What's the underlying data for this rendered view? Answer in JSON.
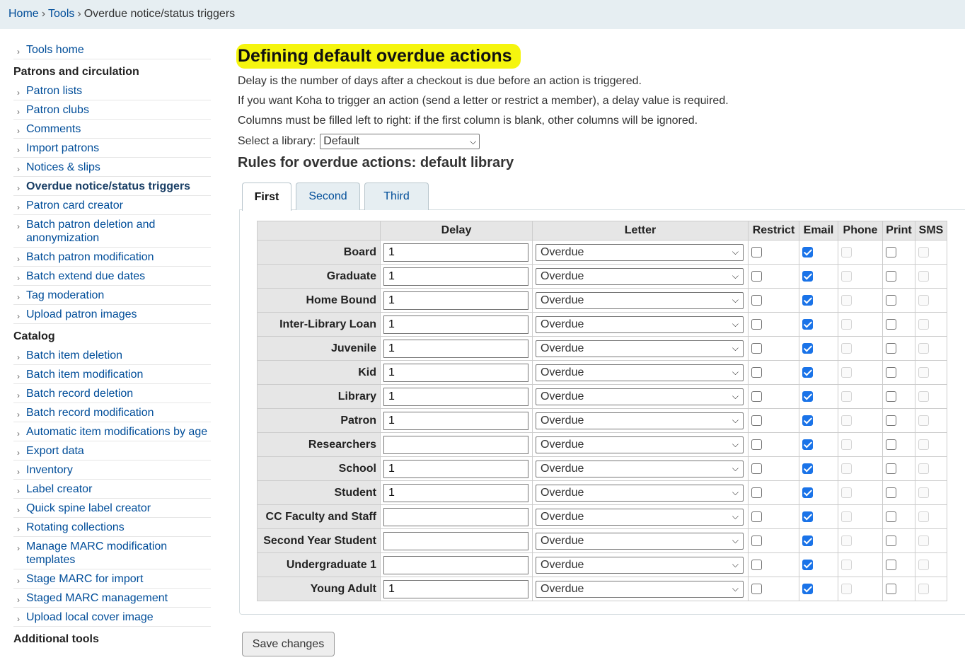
{
  "breadcrumb": {
    "home": "Home",
    "tools": "Tools",
    "current": "Overdue notice/status triggers",
    "separator": "›"
  },
  "sidebar": {
    "top_items": [
      {
        "label": "Tools home"
      }
    ],
    "patrons_heading": "Patrons and circulation",
    "patrons_items": [
      {
        "label": "Patron lists"
      },
      {
        "label": "Patron clubs"
      },
      {
        "label": "Comments"
      },
      {
        "label": "Import patrons"
      },
      {
        "label": "Notices & slips"
      },
      {
        "label": "Overdue notice/status triggers",
        "active": true
      },
      {
        "label": "Patron card creator"
      },
      {
        "label": "Batch patron deletion and anonymization"
      },
      {
        "label": "Batch patron modification"
      },
      {
        "label": "Batch extend due dates"
      },
      {
        "label": "Tag moderation"
      },
      {
        "label": "Upload patron images"
      }
    ],
    "catalog_heading": "Catalog",
    "catalog_items": [
      {
        "label": "Batch item deletion"
      },
      {
        "label": "Batch item modification"
      },
      {
        "label": "Batch record deletion"
      },
      {
        "label": "Batch record modification"
      },
      {
        "label": "Automatic item modifications by age"
      },
      {
        "label": "Export data"
      },
      {
        "label": "Inventory"
      },
      {
        "label": "Label creator"
      },
      {
        "label": "Quick spine label creator"
      },
      {
        "label": "Rotating collections"
      },
      {
        "label": "Manage MARC modification templates"
      },
      {
        "label": "Stage MARC for import"
      },
      {
        "label": "Staged MARC management"
      },
      {
        "label": "Upload local cover image"
      }
    ],
    "additional_heading": "Additional tools"
  },
  "main": {
    "title": "Defining default overdue actions",
    "para1": "Delay is the number of days after a checkout is due before an action is triggered.",
    "para2": "If you want Koha to trigger an action (send a letter or restrict a member), a delay value is required.",
    "para3": "Columns must be filled left to right: if the first column is blank, other columns will be ignored.",
    "library_label": "Select a library:",
    "library_value": "Default",
    "rules_title": "Rules for overdue actions: default library",
    "tabs": [
      {
        "label": "First",
        "active": true
      },
      {
        "label": "Second"
      },
      {
        "label": "Third"
      }
    ],
    "columns": {
      "category": "",
      "delay": "Delay",
      "letter": "Letter",
      "restrict": "Restrict",
      "email": "Email",
      "phone": "Phone",
      "print": "Print",
      "sms": "SMS"
    },
    "rows": [
      {
        "category": "Board",
        "delay": "1",
        "letter": "Overdue",
        "restrict": false,
        "email": true,
        "print": false
      },
      {
        "category": "Graduate",
        "delay": "1",
        "letter": "Overdue",
        "restrict": false,
        "email": true,
        "print": false
      },
      {
        "category": "Home Bound",
        "delay": "1",
        "letter": "Overdue",
        "restrict": false,
        "email": true,
        "print": false
      },
      {
        "category": "Inter-Library Loan",
        "delay": "1",
        "letter": "Overdue",
        "restrict": false,
        "email": true,
        "print": false
      },
      {
        "category": "Juvenile",
        "delay": "1",
        "letter": "Overdue",
        "restrict": false,
        "email": true,
        "print": false
      },
      {
        "category": "Kid",
        "delay": "1",
        "letter": "Overdue",
        "restrict": false,
        "email": true,
        "print": false
      },
      {
        "category": "Library",
        "delay": "1",
        "letter": "Overdue",
        "restrict": false,
        "email": true,
        "print": false
      },
      {
        "category": "Patron",
        "delay": "1",
        "letter": "Overdue",
        "restrict": false,
        "email": true,
        "print": false
      },
      {
        "category": "Researchers",
        "delay": "",
        "letter": "Overdue",
        "restrict": false,
        "email": true,
        "print": false
      },
      {
        "category": "School",
        "delay": "1",
        "letter": "Overdue",
        "restrict": false,
        "email": true,
        "print": false
      },
      {
        "category": "Student",
        "delay": "1",
        "letter": "Overdue",
        "restrict": false,
        "email": true,
        "print": false
      },
      {
        "category": "CC Faculty and Staff",
        "delay": "",
        "letter": "Overdue",
        "restrict": false,
        "email": true,
        "print": false
      },
      {
        "category": "Second Year Student",
        "delay": "",
        "letter": "Overdue",
        "restrict": false,
        "email": true,
        "print": false
      },
      {
        "category": "Undergraduate 1",
        "delay": "",
        "letter": "Overdue",
        "restrict": false,
        "email": true,
        "print": false
      },
      {
        "category": "Young Adult",
        "delay": "1",
        "letter": "Overdue",
        "restrict": false,
        "email": true,
        "print": false
      }
    ],
    "save_label": "Save changes"
  },
  "colors": {
    "link": "#004d99",
    "highlight": "#f5f50e",
    "breadcrumb_bg": "#e6eef2",
    "checkbox_checked": "#1a73e8"
  }
}
